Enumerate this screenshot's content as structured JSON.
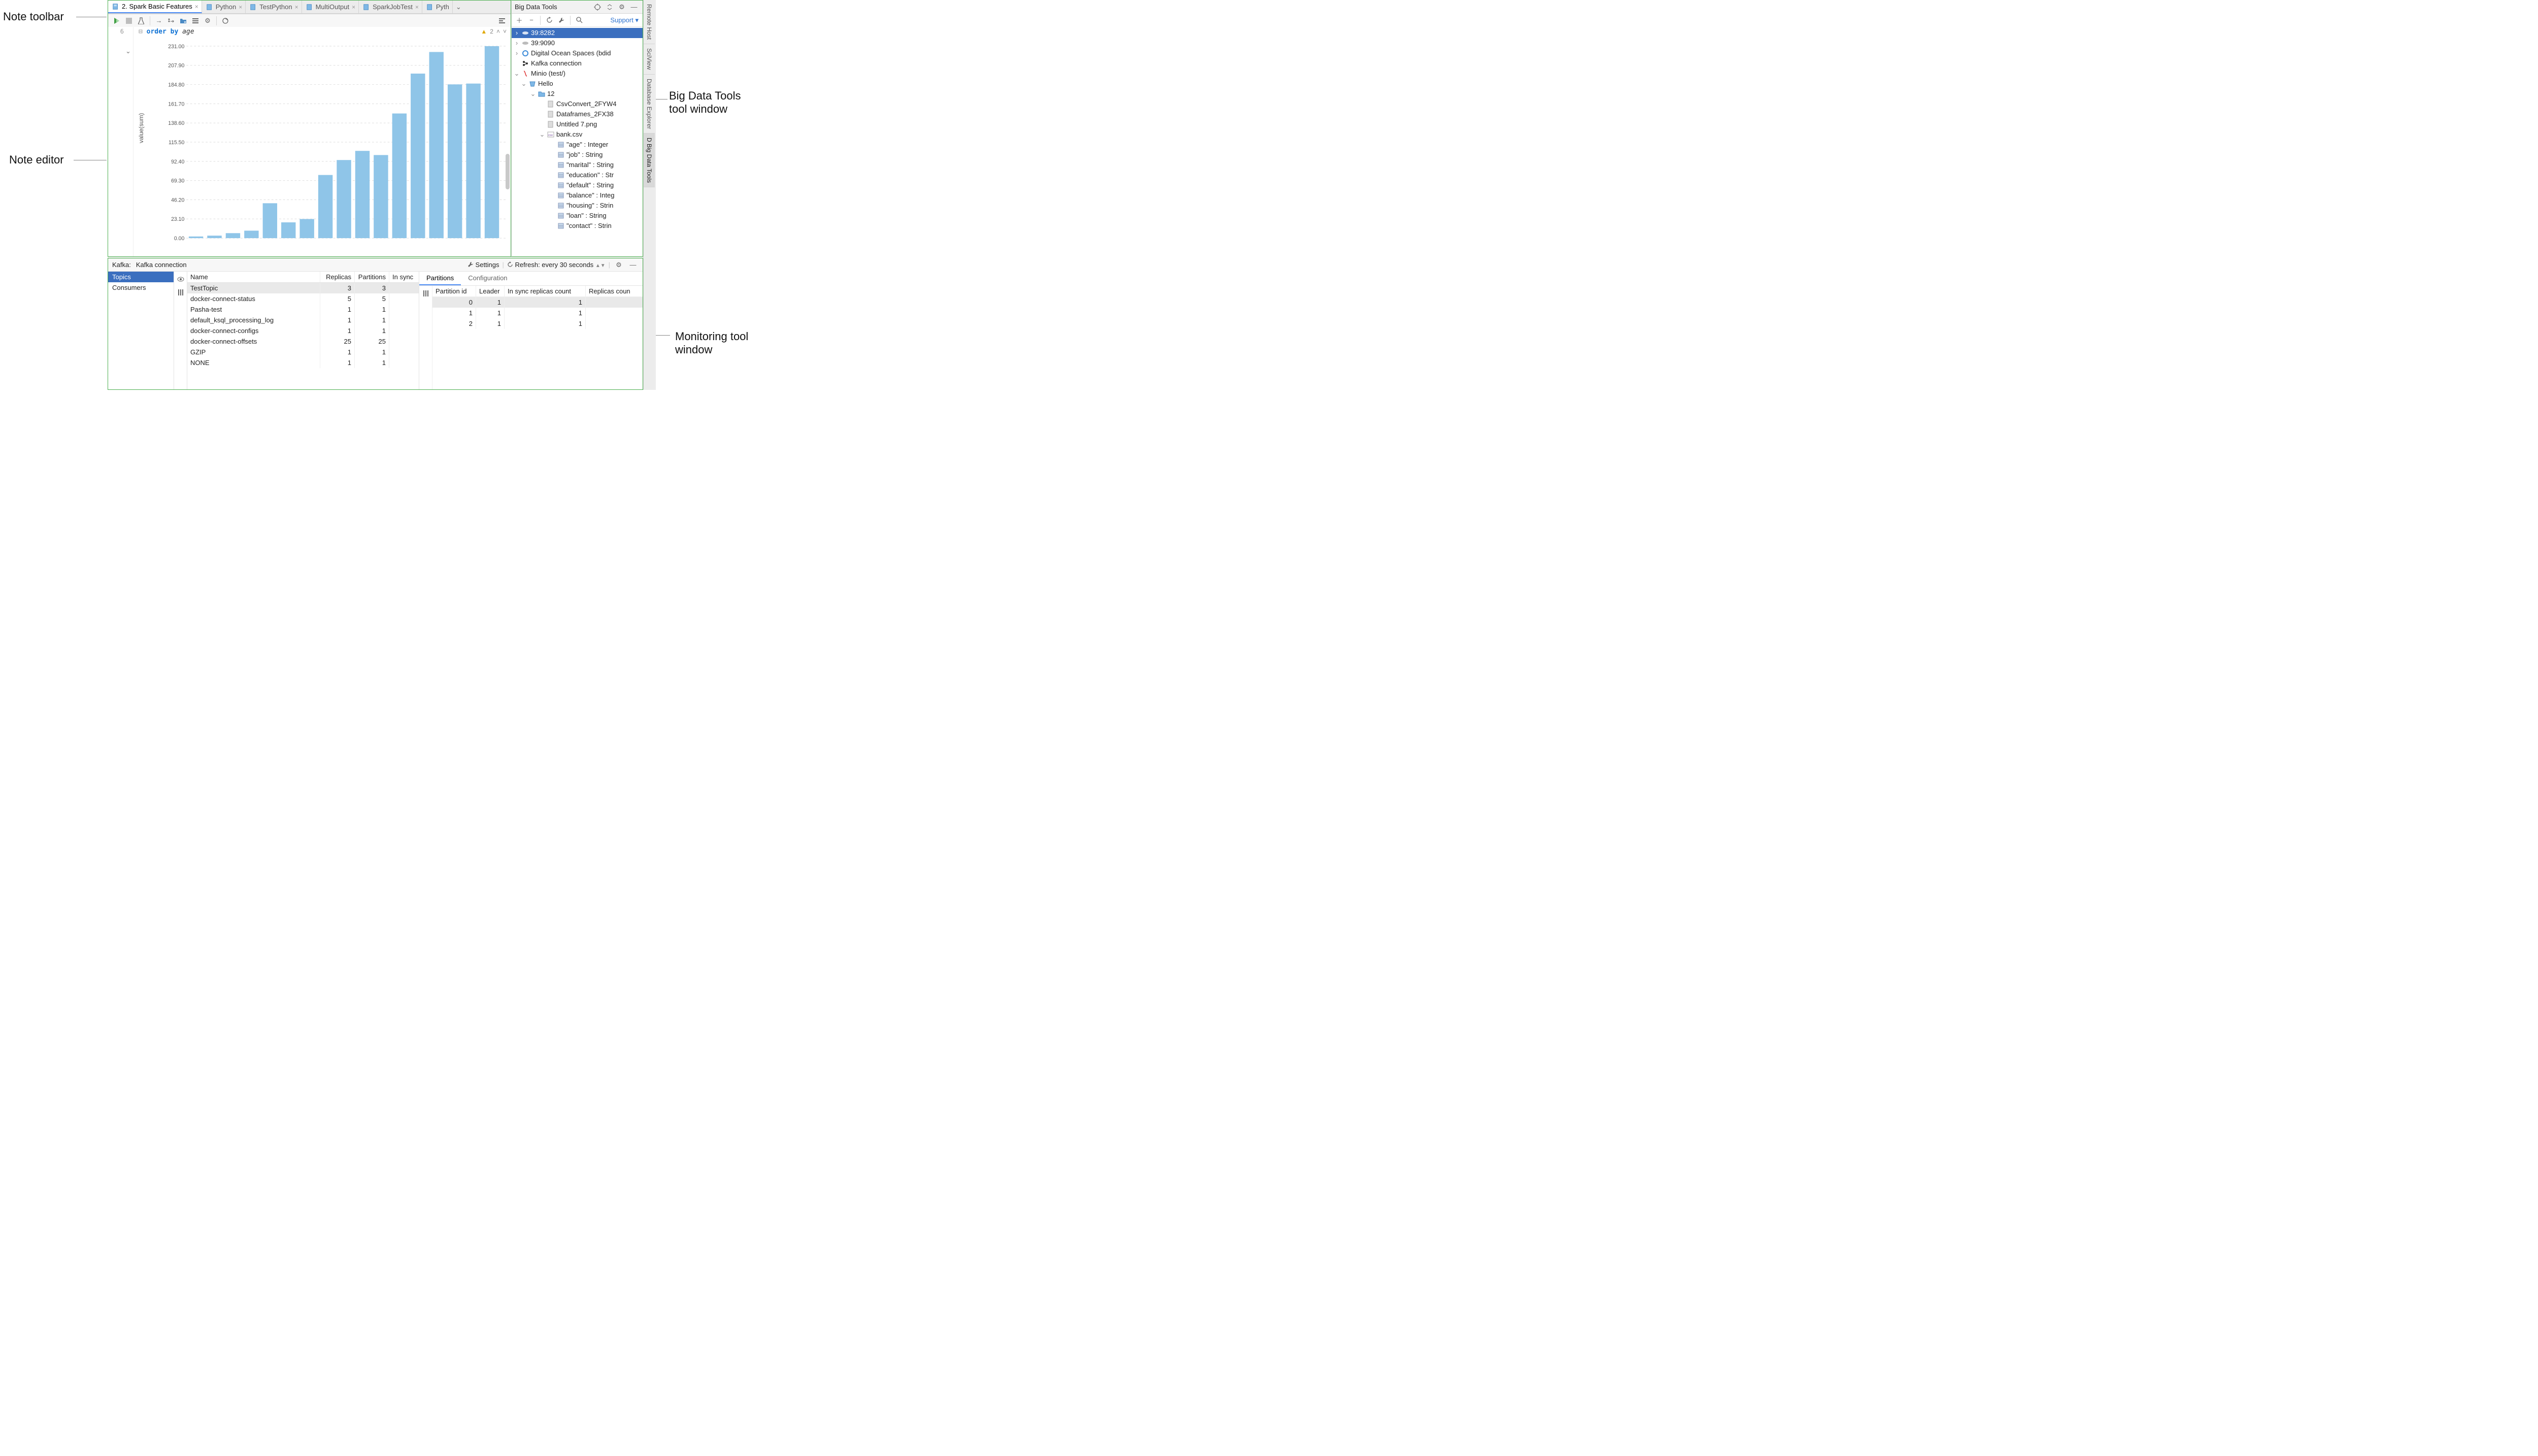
{
  "annotations": {
    "noteToolbar": "Note toolbar",
    "noteEditor": "Note editor",
    "bdtWindow": "Big Data Tools tool window",
    "monitorWindow": "Monitoring tool window"
  },
  "tabs": [
    {
      "label": "2. Spark Basic Features",
      "active": true
    },
    {
      "label": "Python"
    },
    {
      "label": "TestPython"
    },
    {
      "label": "MultiOutput"
    },
    {
      "label": "SparkJobTest"
    },
    {
      "label": "Pyth"
    }
  ],
  "editor": {
    "lineNumber": "6",
    "code": {
      "kw1": "order",
      "kw2": "by",
      "ident": "age"
    },
    "warnCount": "2"
  },
  "chart_data": {
    "type": "bar",
    "ylabel": "value(sum)",
    "yticks": [
      0.0,
      23.1,
      46.2,
      69.3,
      92.4,
      115.5,
      138.6,
      161.7,
      184.8,
      207.9,
      231.0
    ],
    "ylim": [
      0,
      231
    ],
    "values": [
      2,
      3,
      6,
      9,
      42,
      19,
      23,
      76,
      94,
      105,
      100,
      150,
      198,
      224,
      185,
      186,
      231
    ]
  },
  "bdt": {
    "title": "Big Data Tools",
    "support": "Support",
    "tree": {
      "n1": "39:8282",
      "n2": "39:9090",
      "n3": "Digital Ocean Spaces (bdid",
      "n4": "Kafka connection",
      "n5": "Minio (test/)",
      "n6": "Hello",
      "n7": "12",
      "n8": "CsvConvert_2FYW4",
      "n9": "Dataframes_2FX38",
      "n10": "Untitled 7.png",
      "n11": "bank.csv",
      "cols": [
        "\"age\" : Integer",
        "\"job\" : String",
        "\"marital\" : String",
        "\"education\" : Str",
        "\"default\" : String",
        "\"balance\" : Integ",
        "\"housing\" : Strin",
        "\"loan\" : String",
        "\"contact\" : Strin"
      ]
    }
  },
  "sideTabs": [
    "Remote Host",
    "SciView",
    "Database Explorer",
    "D Big Data Tools"
  ],
  "kafka": {
    "label": "Kafka:",
    "conn": "Kafka connection",
    "settings": "Settings",
    "refresh": "Refresh: every 30 seconds",
    "left": [
      "Topics",
      "Consumers"
    ],
    "columns": [
      "Name",
      "Replicas",
      "Partitions",
      "In sync"
    ],
    "rows": [
      {
        "name": "TestTopic",
        "replicas": 3,
        "partitions": 3,
        "selected": true
      },
      {
        "name": "docker-connect-status",
        "replicas": 5,
        "partitions": 5
      },
      {
        "name": "Pasha-test",
        "replicas": 1,
        "partitions": 1
      },
      {
        "name": "default_ksql_processing_log",
        "replicas": 1,
        "partitions": 1
      },
      {
        "name": "docker-connect-configs",
        "replicas": 1,
        "partitions": 1
      },
      {
        "name": "docker-connect-offsets",
        "replicas": 25,
        "partitions": 25
      },
      {
        "name": "GZIP",
        "replicas": 1,
        "partitions": 1
      },
      {
        "name": "NONE",
        "replicas": 1,
        "partitions": 1
      }
    ],
    "rightTabs": [
      "Partitions",
      "Configuration"
    ],
    "rightCols": [
      "Partition id",
      "Leader",
      "In sync replicas count",
      "Replicas coun"
    ],
    "partitions": [
      {
        "id": 0,
        "leader": 1,
        "insync": 1,
        "selected": true
      },
      {
        "id": 1,
        "leader": 1,
        "insync": 1
      },
      {
        "id": 2,
        "leader": 1,
        "insync": 1
      }
    ]
  }
}
